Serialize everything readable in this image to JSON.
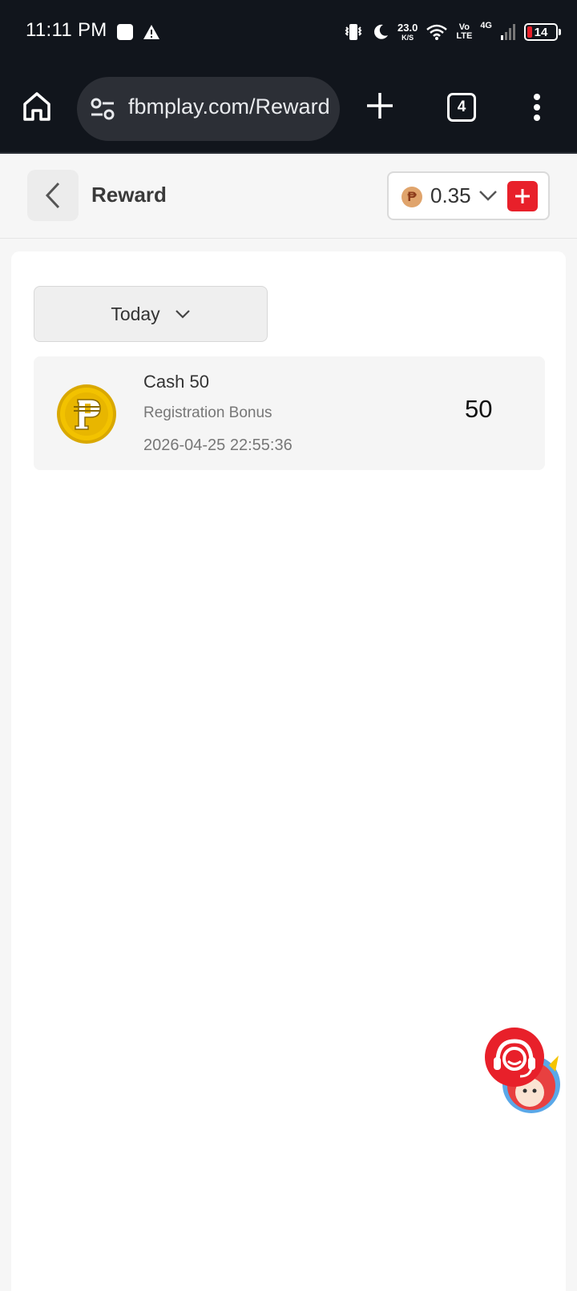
{
  "status_bar": {
    "time": "11:11 PM",
    "net_speed_value": "23.0",
    "net_speed_unit": "K/S",
    "volte_top": "Vo",
    "volte_bottom": "LTE",
    "network_type": "4G",
    "battery_level": "14"
  },
  "browser": {
    "url": "fbmplay.com/Reward",
    "tab_count": "4"
  },
  "header": {
    "title": "Reward",
    "currency_symbol": "₱",
    "balance": "0.35"
  },
  "filter": {
    "selected": "Today"
  },
  "rewards": [
    {
      "title": "Cash 50",
      "subtitle": "Registration Bonus",
      "timestamp": "2026-04-25 22:55:36",
      "amount": "50",
      "icon": "peso-coin-icon"
    }
  ],
  "colors": {
    "accent_red": "#e8202a",
    "coin_gold": "#e6b400",
    "system_bar": "#11151c"
  }
}
